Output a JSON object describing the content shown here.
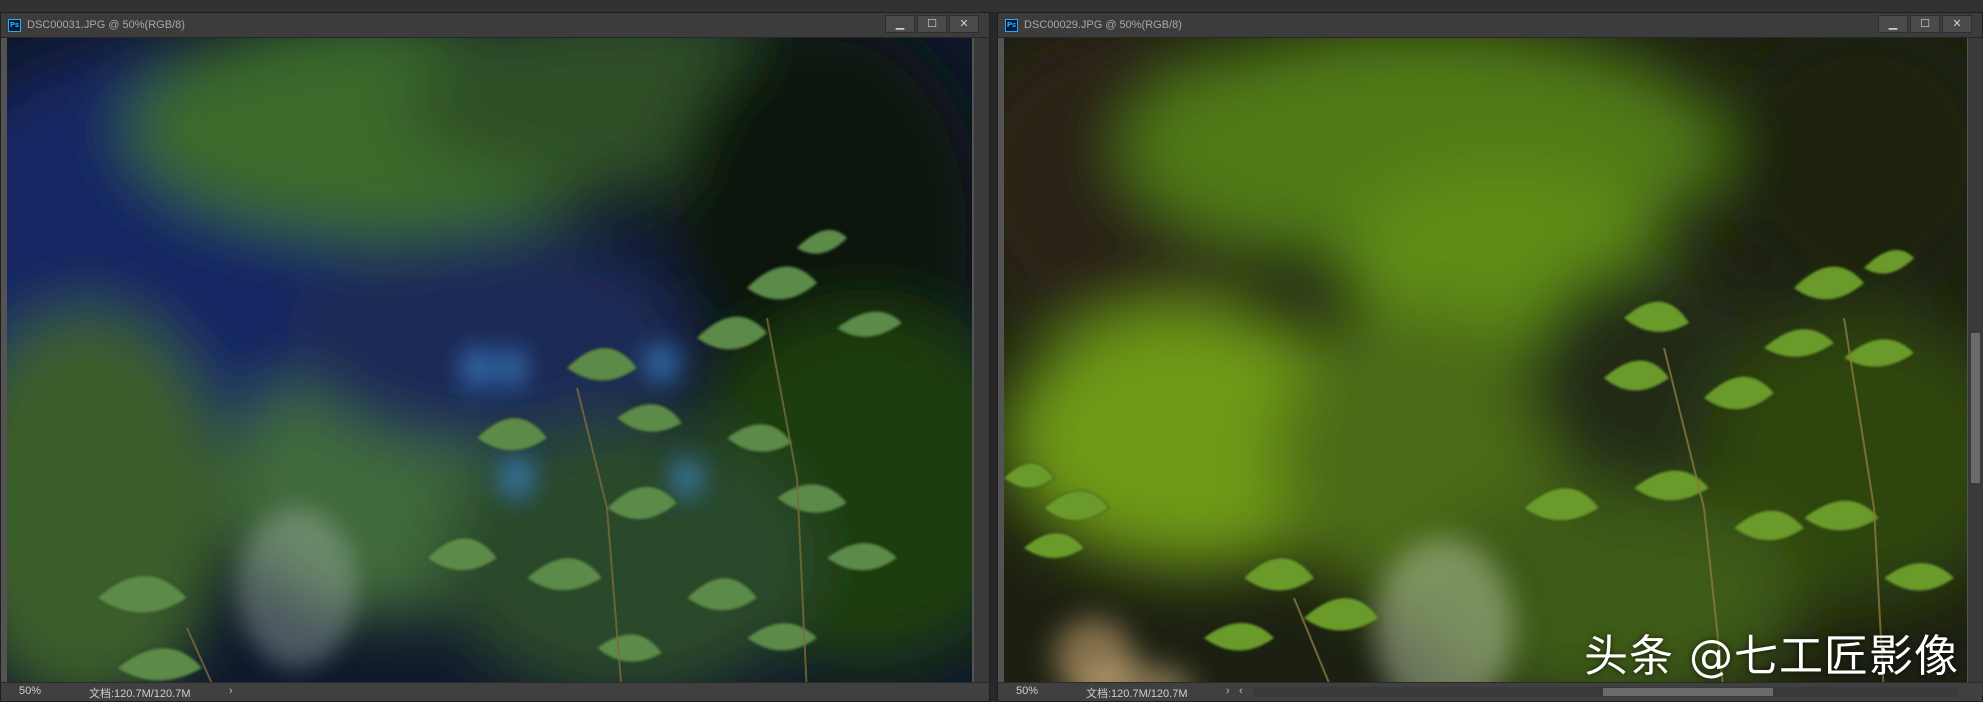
{
  "windows": [
    {
      "title": "DSC00031.JPG @ 50%(RGB/8)",
      "app_icon_label": "Ps",
      "buttons": {
        "minimize": "▁",
        "restore": "☐",
        "close": "✕"
      },
      "status": {
        "zoom": "50%",
        "doc_size": "文档:120.7M/120.7M",
        "arrow": "›"
      }
    },
    {
      "title": "DSC00029.JPG @ 50%(RGB/8)",
      "app_icon_label": "Ps",
      "buttons": {
        "minimize": "▁",
        "restore": "☐",
        "close": "✕"
      },
      "status": {
        "zoom": "50%",
        "doc_size": "文档:120.7M/120.7M",
        "arrow_right": "›",
        "arrow_left": "‹"
      }
    }
  ],
  "watermark": "头条 @七工匠影像",
  "colors": {
    "panel": "#535353",
    "titlebar": "#3c3c3c",
    "workspace": "#282828",
    "ps_blue": "#31a8ff"
  },
  "icons": [
    "photoshop-icon",
    "minimize-icon",
    "restore-icon",
    "close-icon",
    "chevron-right-icon",
    "chevron-left-icon"
  ]
}
